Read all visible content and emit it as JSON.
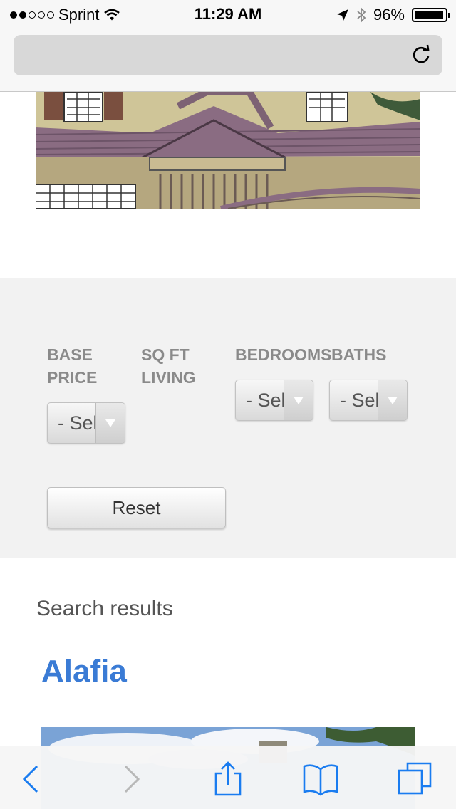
{
  "status_bar": {
    "carrier": "Sprint",
    "time": "11:29 AM",
    "battery_percent": "96%",
    "battery_level": 0.96,
    "signal_filled": 2,
    "signal_total": 5
  },
  "address_bar": {
    "url": ""
  },
  "filters": {
    "base_price": {
      "label": "BASE\nPRICE",
      "value": "- Select -"
    },
    "sqft": {
      "label": "SQ FT\nLIVING"
    },
    "bedrooms": {
      "label": "BEDROOMS",
      "value": "- Select -"
    },
    "baths": {
      "label": "BATHS",
      "value": "- Select -"
    },
    "reset_label": "Reset"
  },
  "results": {
    "heading": "Search results",
    "items": [
      {
        "title": "Alafia"
      }
    ]
  },
  "toolbar": {
    "back_enabled": true,
    "forward_enabled": false,
    "accent": "#1a7cf0"
  }
}
